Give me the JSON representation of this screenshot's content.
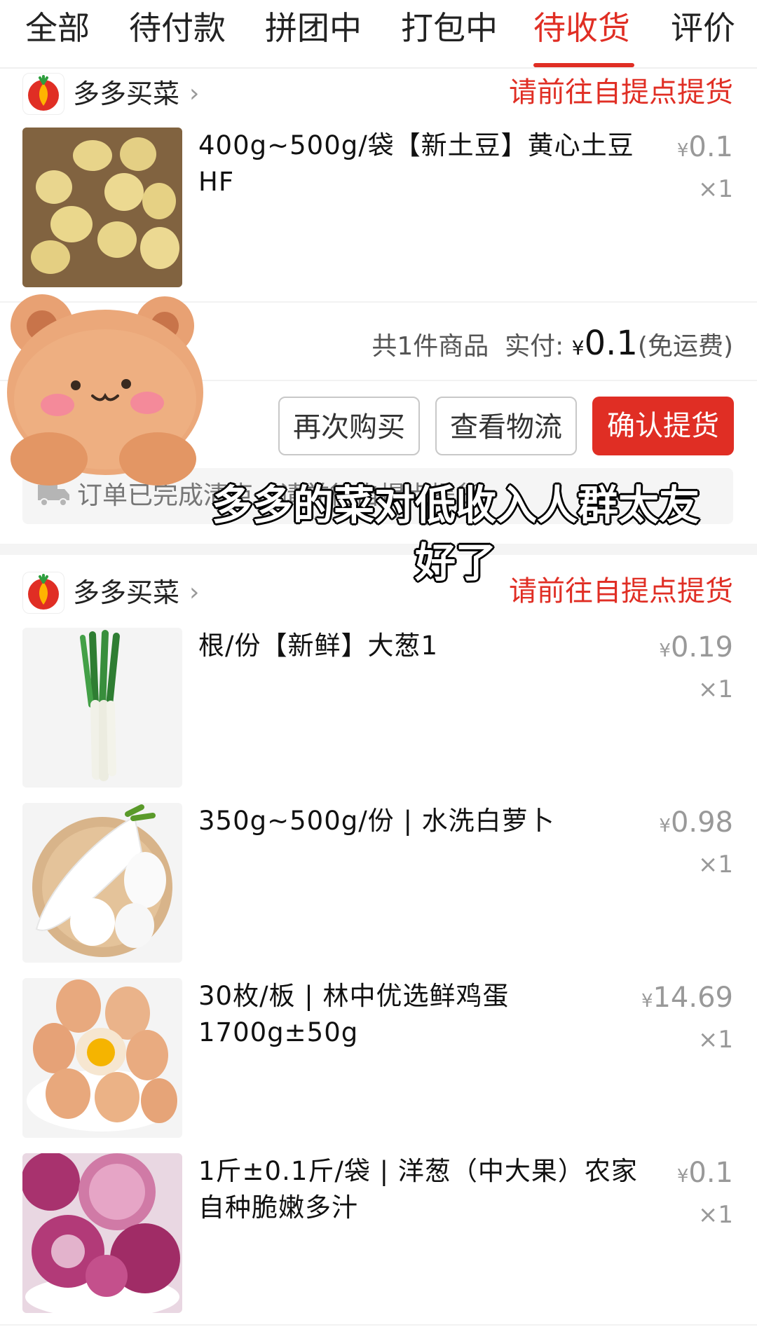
{
  "tabs": [
    {
      "label": "全部"
    },
    {
      "label": "待付款"
    },
    {
      "label": "拼团中"
    },
    {
      "label": "打包中"
    },
    {
      "label": "待收货"
    },
    {
      "label": "评价"
    }
  ],
  "active_tab": "待收货",
  "accent_color": "#e02e24",
  "orders": [
    {
      "store_name": "多多买菜",
      "pickup_note": "请前往自提点提货",
      "items": [
        {
          "name": "400g~500g/袋【新土豆】黄心土豆HF",
          "currency": "¥",
          "price": "0.1",
          "qty": "×1",
          "image": "potato"
        }
      ],
      "summary": {
        "count_text": "共1件商品",
        "paid_label": "实付:",
        "currency": "¥",
        "amount": "0.1",
        "shipping_note": "(免运费)"
      },
      "buttons": {
        "buy_again": "再次购买",
        "view_logistics": "查看物流",
        "confirm_pickup": "确认提货"
      },
      "logistics_text": "订单已完成清点，请前往自提点提货"
    },
    {
      "store_name": "多多买菜",
      "pickup_note": "请前往自提点提货",
      "items": [
        {
          "name": "根/份【新鲜】大葱1",
          "currency": "¥",
          "price": "0.19",
          "qty": "×1",
          "image": "scallion"
        },
        {
          "name": "350g~500g/份 | 水洗白萝卜",
          "currency": "¥",
          "price": "0.98",
          "qty": "×1",
          "image": "radish"
        },
        {
          "name": "30枚/板 | 林中优选鲜鸡蛋1700g±50g",
          "currency": "¥",
          "price": "14.69",
          "qty": "×1",
          "image": "eggs"
        },
        {
          "name": "1斤±0.1斤/袋 | 洋葱（中大果）农家自种脆嫩多汁",
          "currency": "¥",
          "price": "0.1",
          "qty": "×1",
          "image": "onion"
        }
      ]
    }
  ],
  "overlay_caption": "多多的菜对低收入人群太友好了"
}
